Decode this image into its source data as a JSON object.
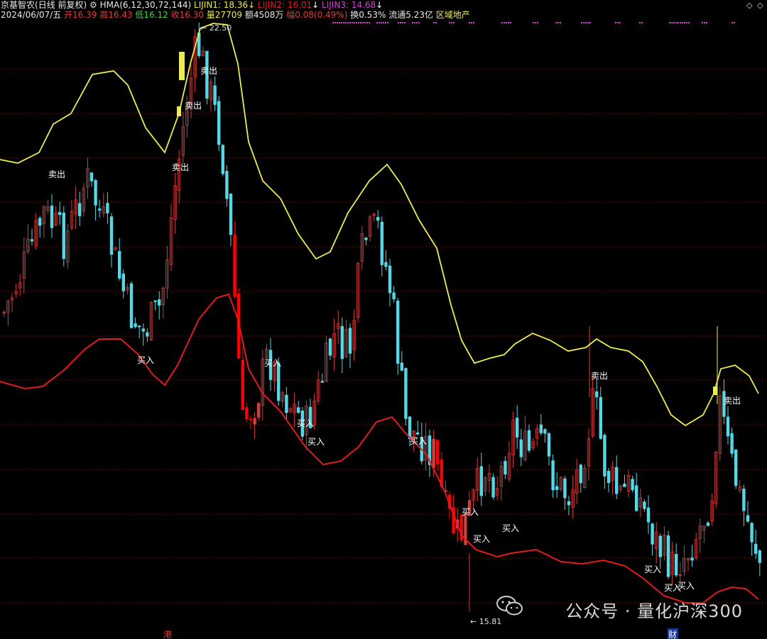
{
  "header": {
    "line1": {
      "stock_name": "京基智农",
      "indicator_prefix": "HMA(6,12,30,72,144)",
      "lijin1_label": "LIJIN1: 18.36",
      "lijin2_label": "LIJIN2: 16.01",
      "lijin3_label": "LIJIN3: 14.68",
      "arrow_glyph": "↓",
      "period": "(日线 前复权)"
    },
    "line2": {
      "date": "2024/06/07/五",
      "open": "开16.39",
      "high": "高16.43",
      "low": "低16.12",
      "close": "收16.30",
      "volume": "量27709",
      "amount": "额4508万",
      "change": "幅0.08(0.49%)",
      "turnover": "换0.53%",
      "float_cap": "流通5.23亿",
      "sector": "区域地产"
    },
    "controls": {
      "left": "◇",
      "right": "◇"
    }
  },
  "markers": {
    "high_label": "← 22.50",
    "low_label": "← 15.81",
    "bottom_left_tag": "港",
    "bottom_right_tag": "财"
  },
  "watermark": "公众号 · 量化沪深300",
  "colors": {
    "background": "#000000",
    "up_candle": "#d23c3c",
    "down_candle": "#54d8e6",
    "upper_band": "#ecec50",
    "lower_band": "#e21c1c",
    "grid": "#8a1e1e",
    "sell_text": "#ffffff",
    "buy_text": "#ffffff",
    "purple": "#d83cd8"
  },
  "chart_data": {
    "type": "candlestick",
    "title": "京基智农 HMA(6,12,30,72,144)",
    "ylim": [
      15.5,
      22.8
    ],
    "grid": true,
    "signals": {
      "sell": [
        "卖出",
        "卖出",
        "卖出",
        "卖出",
        "卖出",
        "卖出"
      ],
      "buy": [
        "买入",
        "买入",
        "买入",
        "买入",
        "买入",
        "买入",
        "买入",
        "买入",
        "买入",
        "买入",
        "买入",
        "买入",
        "买入"
      ]
    },
    "series": [
      {
        "name": "LIJIN1",
        "description": "upper band (yellow)"
      },
      {
        "name": "LIJIN3",
        "description": "lower band (red)"
      }
    ],
    "price_high": 22.5,
    "price_low": 15.81,
    "last_close": 16.3
  }
}
